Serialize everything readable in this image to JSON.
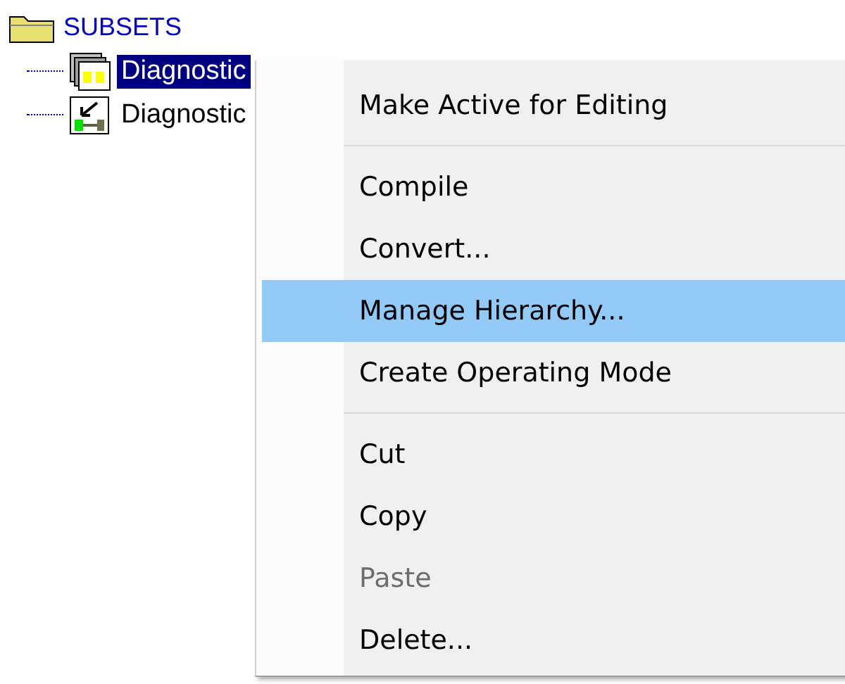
{
  "tree": {
    "label": "SUBSETS",
    "children": [
      {
        "label": "Diagnostic",
        "kind": "stack",
        "selected": true
      },
      {
        "label": "Diagnostic",
        "kind": "arrow",
        "selected": false
      }
    ]
  },
  "context_menu": {
    "groups": [
      [
        {
          "label": "Make Active for Editing",
          "disabled": false,
          "selected": false
        }
      ],
      [
        {
          "label": "Compile",
          "disabled": false,
          "selected": false
        },
        {
          "label": "Convert...",
          "disabled": false,
          "selected": false
        },
        {
          "label": "Manage Hierarchy...",
          "disabled": false,
          "selected": true
        },
        {
          "label": "Create Operating Mode",
          "disabled": false,
          "selected": false
        }
      ],
      [
        {
          "label": "Cut",
          "disabled": false,
          "selected": false
        },
        {
          "label": "Copy",
          "disabled": false,
          "selected": false
        },
        {
          "label": "Paste",
          "disabled": true,
          "selected": false
        },
        {
          "label": "Delete...",
          "disabled": false,
          "selected": false
        }
      ]
    ]
  }
}
